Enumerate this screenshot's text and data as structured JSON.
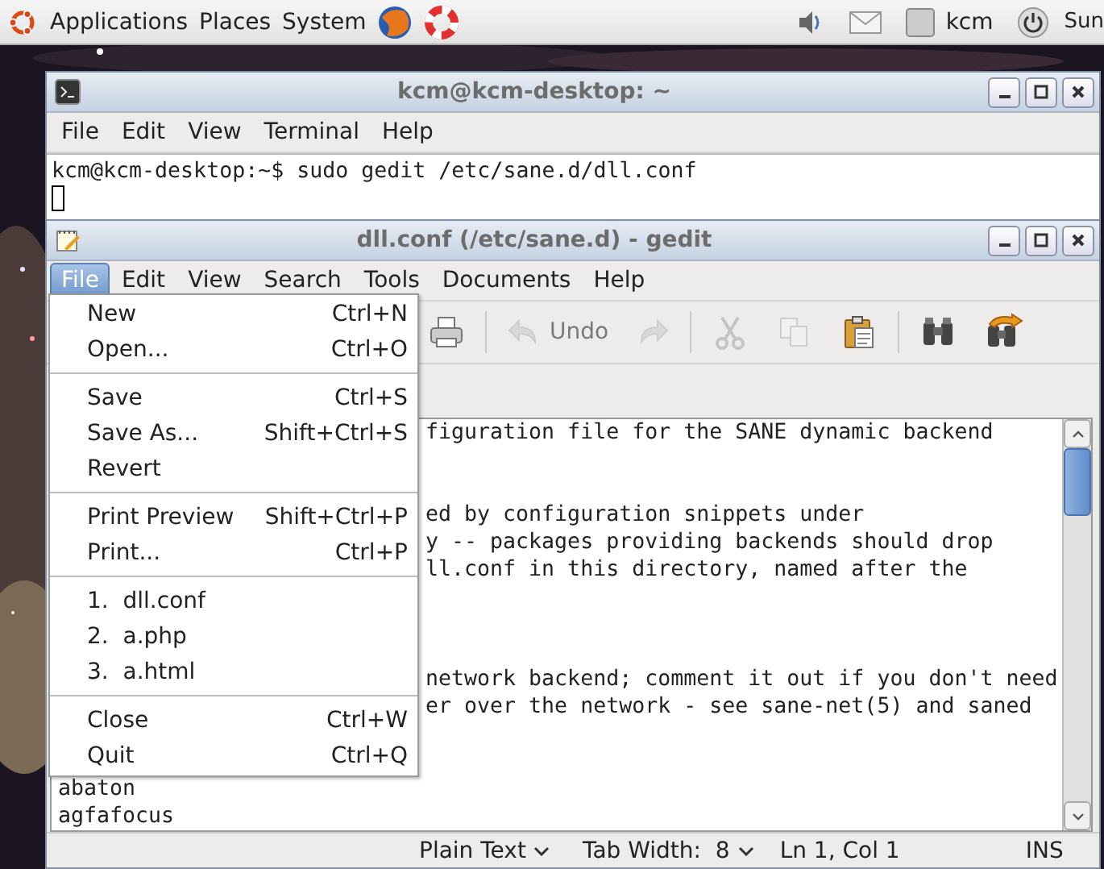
{
  "top_panel": {
    "menus": [
      "Applications",
      "Places",
      "System"
    ],
    "user": "kcm",
    "clock": "Sun"
  },
  "terminal": {
    "title": "kcm@kcm-desktop: ~",
    "menu": [
      "File",
      "Edit",
      "View",
      "Terminal",
      "Help"
    ],
    "lines": [
      "kcm@kcm-desktop:~$ sudo gedit /etc/sane.d/dll.conf"
    ]
  },
  "gedit": {
    "title": "dll.conf (/etc/sane.d) - gedit",
    "menu": [
      {
        "label": "File",
        "selected": true
      },
      {
        "label": "Edit",
        "selected": false
      },
      {
        "label": "View",
        "selected": false
      },
      {
        "label": "Search",
        "selected": false
      },
      {
        "label": "Tools",
        "selected": false
      },
      {
        "label": "Documents",
        "selected": false
      },
      {
        "label": "Help",
        "selected": false
      }
    ],
    "toolbar": [
      {
        "kind": "print",
        "disabled": false
      },
      {
        "kind": "separator"
      },
      {
        "kind": "undo",
        "label": "Undo",
        "disabled": true
      },
      {
        "kind": "redo",
        "disabled": true
      },
      {
        "kind": "separator"
      },
      {
        "kind": "cut",
        "disabled": true
      },
      {
        "kind": "copy",
        "disabled": true
      },
      {
        "kind": "paste",
        "disabled": false
      },
      {
        "kind": "separator"
      },
      {
        "kind": "find",
        "disabled": false
      },
      {
        "kind": "replace",
        "disabled": false
      }
    ],
    "lines": [
      {
        "kind": "behind_menu",
        "text": "figuration file for the SANE dynamic backend"
      },
      {
        "kind": "blank"
      },
      {
        "kind": "blank"
      },
      {
        "kind": "behind_menu",
        "text": "ed by configuration snippets under"
      },
      {
        "kind": "behind_menu",
        "text": "y -- packages providing backends should drop"
      },
      {
        "kind": "behind_menu",
        "text": "ll.conf in this directory, named after the"
      },
      {
        "kind": "blank"
      },
      {
        "kind": "blank"
      },
      {
        "kind": "blank"
      },
      {
        "kind": "behind_menu",
        "text": "network backend; comment it out if you don't need"
      },
      {
        "kind": "behind_menu",
        "text": "er over the network - see sane-net(5) and saned"
      },
      {
        "kind": "blank"
      },
      {
        "kind": "blank"
      },
      {
        "kind": "full",
        "text": "abaton"
      },
      {
        "kind": "full",
        "text": "agfafocus"
      }
    ],
    "status": {
      "language": "Plain Text",
      "tab_width": "Tab Width:  8",
      "position": "Ln 1, Col 1",
      "mode": "INS"
    },
    "file_menu": [
      {
        "kind": "item",
        "label": "New",
        "shortcut": "Ctrl+N"
      },
      {
        "kind": "item",
        "label": "Open...",
        "shortcut": "Ctrl+O"
      },
      {
        "kind": "separator"
      },
      {
        "kind": "item",
        "label": "Save",
        "shortcut": "Ctrl+S"
      },
      {
        "kind": "item",
        "label": "Save As...",
        "shortcut": "Shift+Ctrl+S"
      },
      {
        "kind": "item",
        "label": "Revert"
      },
      {
        "kind": "separator"
      },
      {
        "kind": "item",
        "label": "Print Preview",
        "shortcut": "Shift+Ctrl+P"
      },
      {
        "kind": "item",
        "label": "Print...",
        "shortcut": "Ctrl+P"
      },
      {
        "kind": "separator"
      },
      {
        "kind": "item",
        "label": "1.  dll.conf"
      },
      {
        "kind": "item",
        "label": "2.  a.php"
      },
      {
        "kind": "item",
        "label": "3.  a.html"
      },
      {
        "kind": "separator"
      },
      {
        "kind": "item",
        "label": "Close",
        "shortcut": "Ctrl+W"
      },
      {
        "kind": "item",
        "label": "Quit",
        "shortcut": "Ctrl+Q"
      }
    ]
  }
}
